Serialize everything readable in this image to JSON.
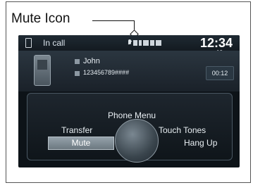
{
  "callout": {
    "label": "Mute Icon"
  },
  "status_bar": {
    "call_status": "In call",
    "time": "12:34",
    "signal_text": "10"
  },
  "call": {
    "contact_name": "John",
    "contact_number": "123456789####",
    "duration": "00:12"
  },
  "menu": {
    "items": [
      "Phone Menu",
      "Transfer",
      "Touch Tones",
      "Mute",
      "Hang Up"
    ],
    "selected": "Mute"
  },
  "colors": {
    "screen_bg": "#0d1318",
    "selected_bg": "#8a969f",
    "text": "#e9eff3"
  }
}
